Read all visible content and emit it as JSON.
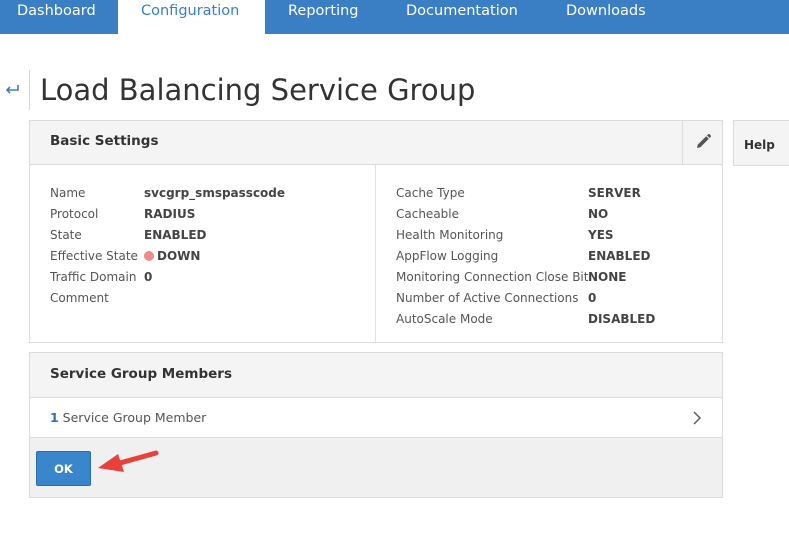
{
  "nav": {
    "tabs": [
      {
        "label": "Dashboard",
        "active": false
      },
      {
        "label": "Configuration",
        "active": true
      },
      {
        "label": "Reporting",
        "active": false
      },
      {
        "label": "Documentation",
        "active": false
      },
      {
        "label": "Downloads",
        "active": false
      }
    ]
  },
  "page": {
    "title": "Load Balancing Service Group"
  },
  "basic_settings": {
    "title": "Basic Settings",
    "left": [
      {
        "label": "Name",
        "value": "svcgrp_smspasscode"
      },
      {
        "label": "Protocol",
        "value": "RADIUS"
      },
      {
        "label": "State",
        "value": "ENABLED"
      },
      {
        "label": "Effective State",
        "value": "DOWN",
        "status_color": "#f08b8b"
      },
      {
        "label": "Traffic Domain",
        "value": "0"
      },
      {
        "label": "Comment",
        "value": ""
      }
    ],
    "right": [
      {
        "label": "Cache Type",
        "value": "SERVER"
      },
      {
        "label": "Cacheable",
        "value": "NO"
      },
      {
        "label": "Health Monitoring",
        "value": "YES"
      },
      {
        "label": "AppFlow Logging",
        "value": "ENABLED"
      },
      {
        "label": "Monitoring Connection Close Bit",
        "value": "NONE"
      },
      {
        "label": "Number of Active Connections",
        "value": "0"
      },
      {
        "label": "AutoScale Mode",
        "value": "DISABLED"
      }
    ]
  },
  "help": {
    "label": "Help"
  },
  "members": {
    "title": "Service Group Members",
    "count": "1",
    "count_label": " Service Group Member"
  },
  "actions": {
    "ok_label": "OK"
  },
  "colors": {
    "nav_bg": "#3a7fc4",
    "accent": "#3a86cc",
    "annotation_arrow": "#e8403a"
  },
  "icons": {
    "back": "back-arrow-icon",
    "edit": "pencil-icon",
    "chevron": "chevron-right-icon",
    "annotation": "red-arrow-icon"
  }
}
